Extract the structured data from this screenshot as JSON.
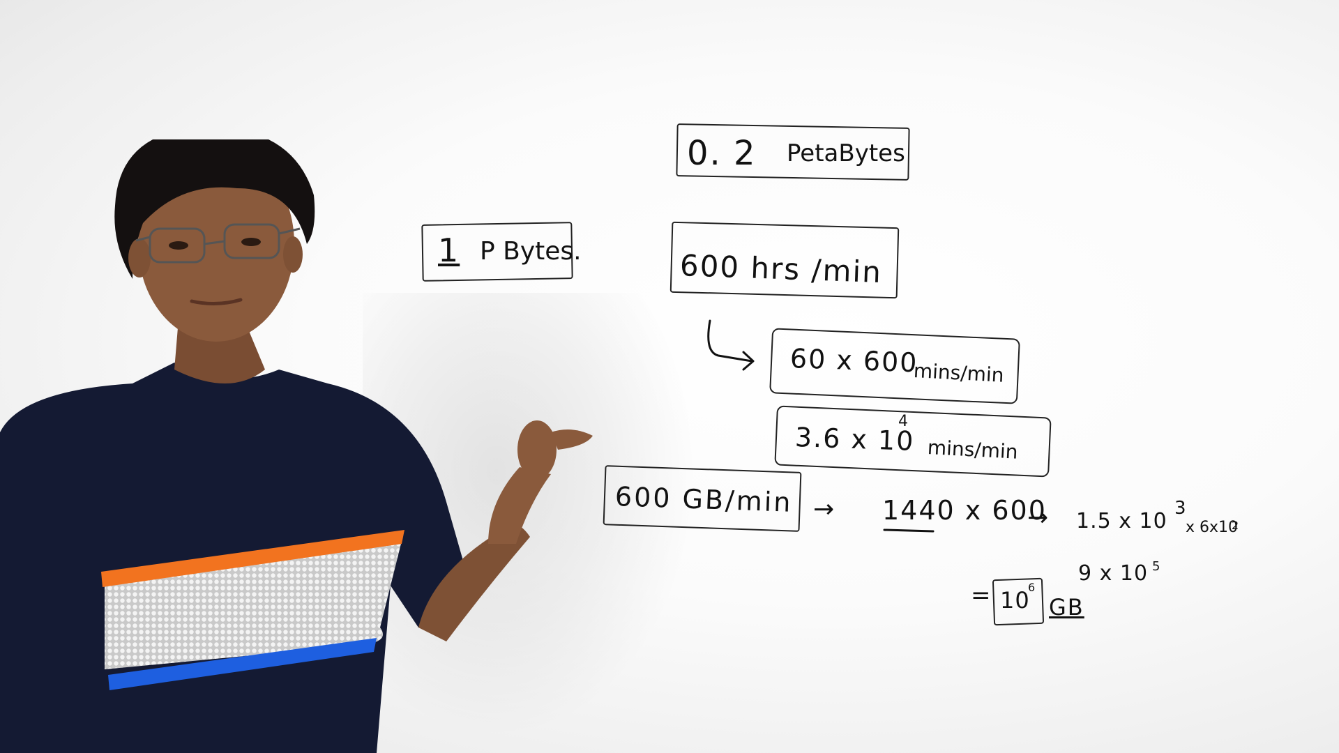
{
  "colors": {
    "board": "#f7f7f7",
    "ink": "#111111",
    "shirt": "#141a33",
    "stripe_orange": "#f2731f",
    "stripe_blue": "#1e5fe0",
    "skin": "#8a5a3c",
    "hair": "#141010"
  },
  "board": {
    "petabytes_02": {
      "num": "0. 2",
      "unit": "PetaBytes"
    },
    "pbytes_1": {
      "num": "1",
      "unit": "P Bytes."
    },
    "hrs_min": "600 hrs /min",
    "mins_min_60": {
      "a": "60 x 600",
      "b": "mins/min"
    },
    "mins_min_36": {
      "a": "3.6 x 10",
      "exp": "4",
      "b": "mins/min"
    },
    "gb_min": "600 GB/min",
    "arrow1": "→",
    "mult_1440": "1440 x 600",
    "arrow2": "→",
    "calc": {
      "a": "1.5 x 10",
      "exp": "3",
      "b": "x 6x10",
      "exp2": "2"
    },
    "result_9": {
      "a": "9 x 10",
      "exp": "5"
    },
    "result": {
      "eq": "=",
      "val": "10",
      "exp": "6",
      "unit": "GB"
    }
  },
  "icons": [
    "curved-arrow-icon",
    "right-arrow-icon"
  ]
}
